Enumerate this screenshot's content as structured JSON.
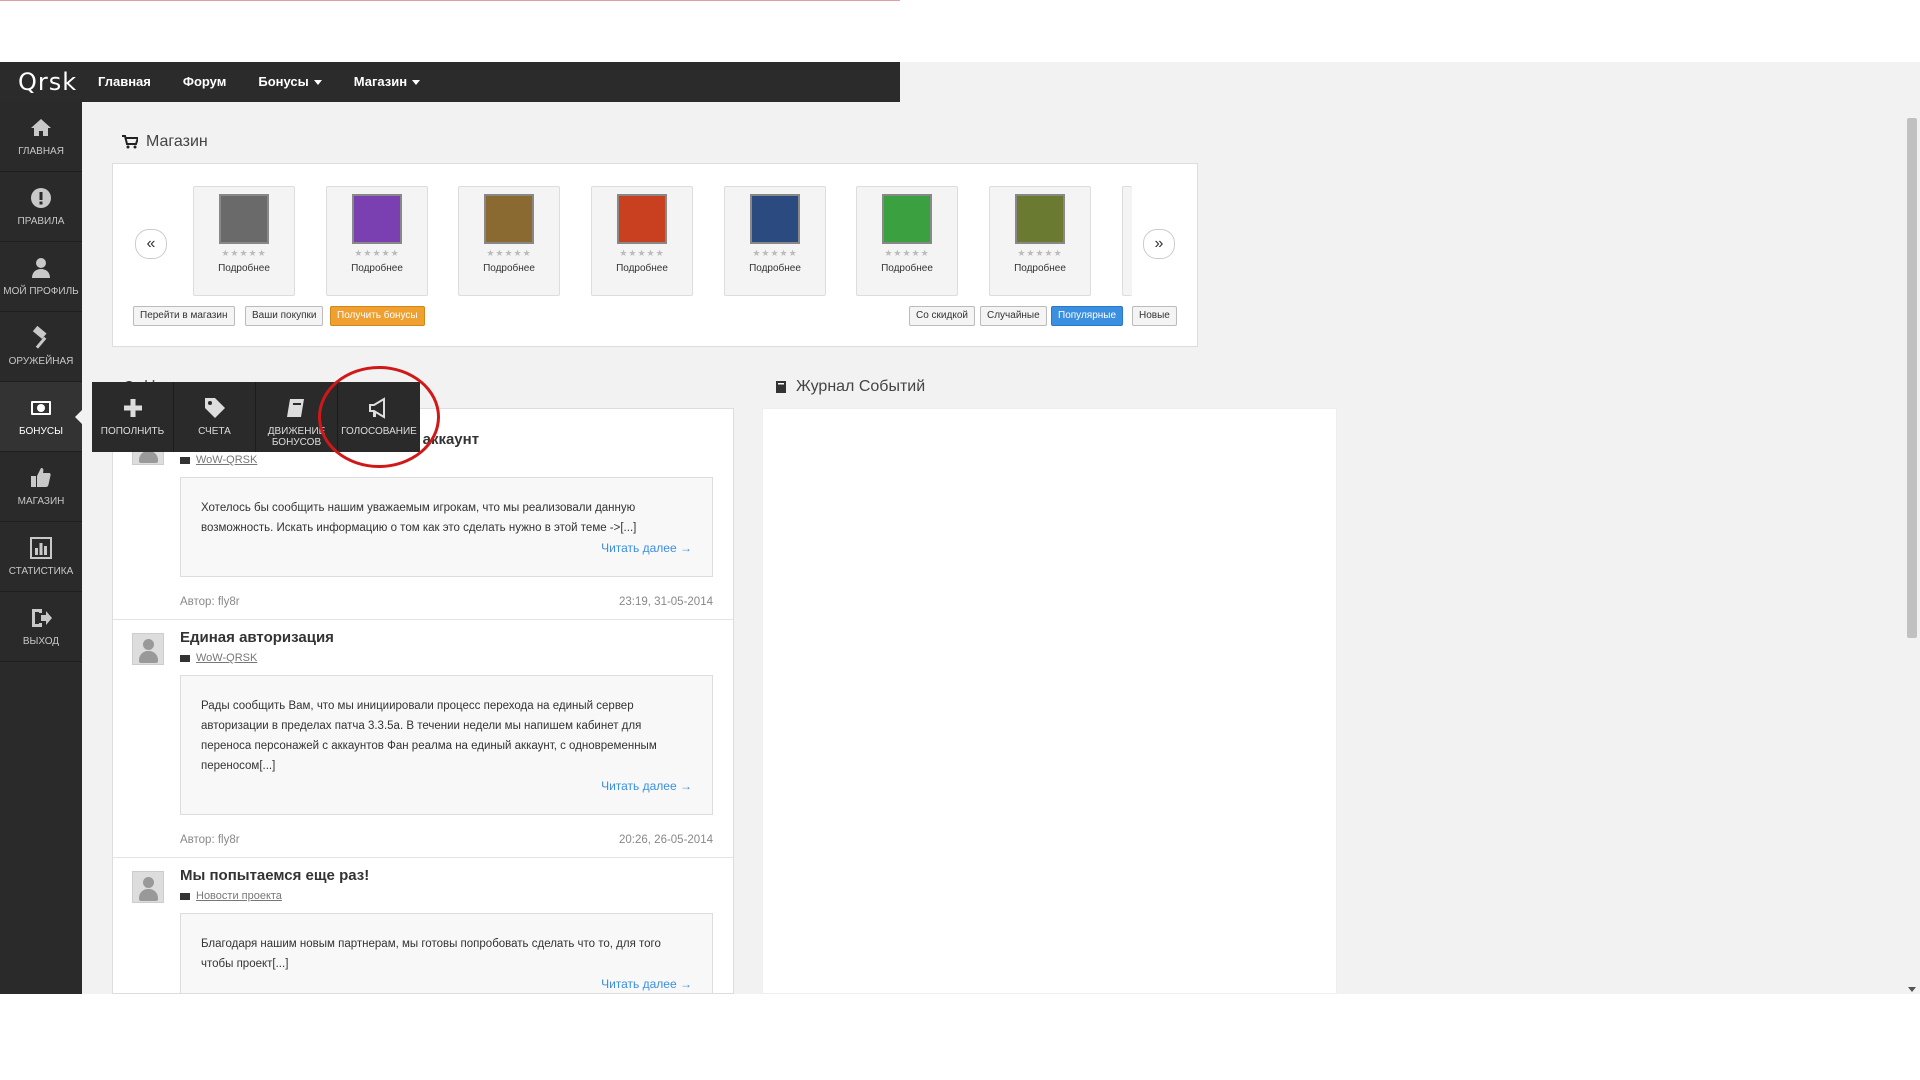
{
  "navbar": {
    "logo": "Qrsk",
    "items": [
      "Главная",
      "Форум",
      "Бонусы",
      "Магазин"
    ]
  },
  "sidebar": {
    "items": [
      {
        "label": "ГЛАВНАЯ",
        "icon": "home-icon"
      },
      {
        "label": "ПРАВИЛА",
        "icon": "alert-icon"
      },
      {
        "label": "МОЙ ПРОФИЛЬ",
        "icon": "user-icon"
      },
      {
        "label": "ОРУЖЕЙНАЯ",
        "icon": "hammer-icon"
      },
      {
        "label": "БОНУСЫ",
        "icon": "money-icon"
      },
      {
        "label": "МАГАЗИН",
        "icon": "thumbs-up-icon"
      },
      {
        "label": "СТАТИСТИКА",
        "icon": "chart-icon"
      },
      {
        "label": "ВЫХОД",
        "icon": "logout-icon"
      }
    ],
    "active": "БОНУСЫ"
  },
  "submenu": {
    "items": [
      {
        "label": "ПОПОЛНИТЬ",
        "icon": "plus-icon"
      },
      {
        "label": "СЧЕТА",
        "icon": "tags-icon"
      },
      {
        "label": "ДВИЖЕНИЕ БОНУСОВ",
        "icon": "book-icon"
      },
      {
        "label": "ГОЛОСОВАНИЕ",
        "icon": "bullhorn-icon"
      }
    ]
  },
  "shop": {
    "title": "Магазин",
    "prev": "«",
    "next": "»",
    "item_more": "Подробнее",
    "item_colors": [
      "#6a6a6a",
      "#7a3fb0",
      "#8a6a30",
      "#c84020",
      "#2a4a80",
      "#3aa040",
      "#6a7a30"
    ],
    "buttons_left": [
      "Перейти в магазин",
      "Ваши покупки",
      "Получить бонусы"
    ],
    "buttons_right": [
      "Со скидкой",
      "Случайные",
      "Популярные",
      "Новые"
    ]
  },
  "news": {
    "title": "Новости",
    "posts": [
      {
        "title": "Переносим персонажей на свой аккаунт",
        "category": "WoW-QRSK",
        "body": "Хотелось бы сообщить нашим уважаемым игрокам, что мы реализовали данную возможность. Искать информацию о том как это сделать нужно в этой теме ->[...]",
        "readmore": "Читать далее →",
        "author": "Автор: fly8r",
        "date": "23:19, 31-05-2014"
      },
      {
        "title": "Единая авторизация",
        "category": "WoW-QRSK",
        "body": "Рады сообщить Вам, что мы инициировали процесс перехода на единый сервер авторизации в пределах патча 3.3.5a. В течении недели мы напишем кабинет для переноса персонажей с аккаунтов Фан реалма на единый аккаунт, с одновременным переносом[...]",
        "readmore": "Читать далее →",
        "author": "Автор: fly8r",
        "date": "20:26, 26-05-2014"
      },
      {
        "title": "Мы попытаемся еще раз!",
        "category": "Новости проекта",
        "body": "Благодаря нашим новым партнерам, мы готовы попробовать сделать что то, для того чтобы проект[...]",
        "readmore": "Читать далее →"
      }
    ]
  },
  "journal": {
    "title": "Журнал Событий"
  }
}
